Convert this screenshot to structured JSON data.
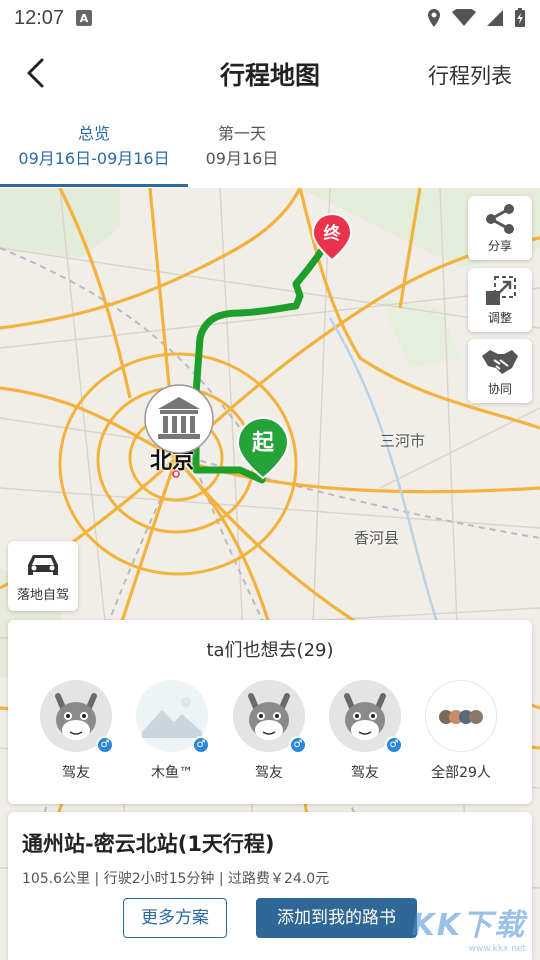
{
  "status_bar": {
    "time": "12:07",
    "app_badge": "A"
  },
  "header": {
    "title": "行程地图",
    "list_link": "行程列表"
  },
  "tabs": [
    {
      "label": "总览",
      "date": "09月16日-09月16日"
    },
    {
      "label": "第一天",
      "date": "09月16日"
    }
  ],
  "map": {
    "city_beijing": "北京",
    "label_sanhe": "三河市",
    "label_xianghe": "香河县",
    "start_marker": "起",
    "end_marker": "终",
    "side_buttons": {
      "share": "分享",
      "adjust": "调整",
      "collab": "协同"
    },
    "selfdrive_label": "落地自驾",
    "route_color": "#1e9e2a"
  },
  "friends": {
    "title": "ta们也想去(29)",
    "items": [
      {
        "name": "驾友",
        "gender": "♂",
        "avatar": "donkey-avatar-icon"
      },
      {
        "name": "木鱼™",
        "gender": "♂",
        "avatar": "mountain-photo-avatar"
      },
      {
        "name": "驾友",
        "gender": "♂",
        "avatar": "donkey-avatar-icon"
      },
      {
        "name": "驾友",
        "gender": "♂",
        "avatar": "donkey-avatar-icon"
      }
    ],
    "all_label": "全部29人"
  },
  "trip": {
    "title": "通州站-密云北站(1天行程)",
    "info": "105.6公里 | 行驶2小时15分钟 | 过路费￥24.0元",
    "more_button": "更多方案",
    "add_button": "添加到我的路书"
  },
  "watermark": {
    "main": "KK下载",
    "sub": "www.kkx.net"
  },
  "colors": {
    "accent": "#2a6aa6",
    "route": "#1e9e2a",
    "end_marker": "#e8334a",
    "road": "#f4b23c"
  }
}
